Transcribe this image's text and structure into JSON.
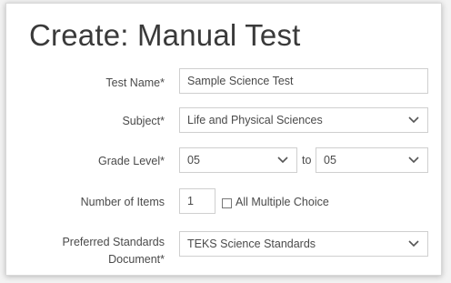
{
  "page": {
    "title": "Create: Manual Test"
  },
  "form": {
    "test_name": {
      "label": "Test Name*",
      "value": "Sample Science Test"
    },
    "subject": {
      "label": "Subject*",
      "value": "Life and Physical Sciences"
    },
    "grade_level": {
      "label": "Grade Level*",
      "from_value": "05",
      "to_text": "to",
      "to_value": "05"
    },
    "number_of_items": {
      "label": "Number of Items",
      "value": "1",
      "checkbox_label": "All Multiple Choice",
      "checkbox_checked": false
    },
    "standards_document": {
      "label": "Preferred Standards Document*",
      "value": "TEKS Science Standards"
    }
  },
  "icons": {
    "dropdown": "chevron-down-icon"
  }
}
